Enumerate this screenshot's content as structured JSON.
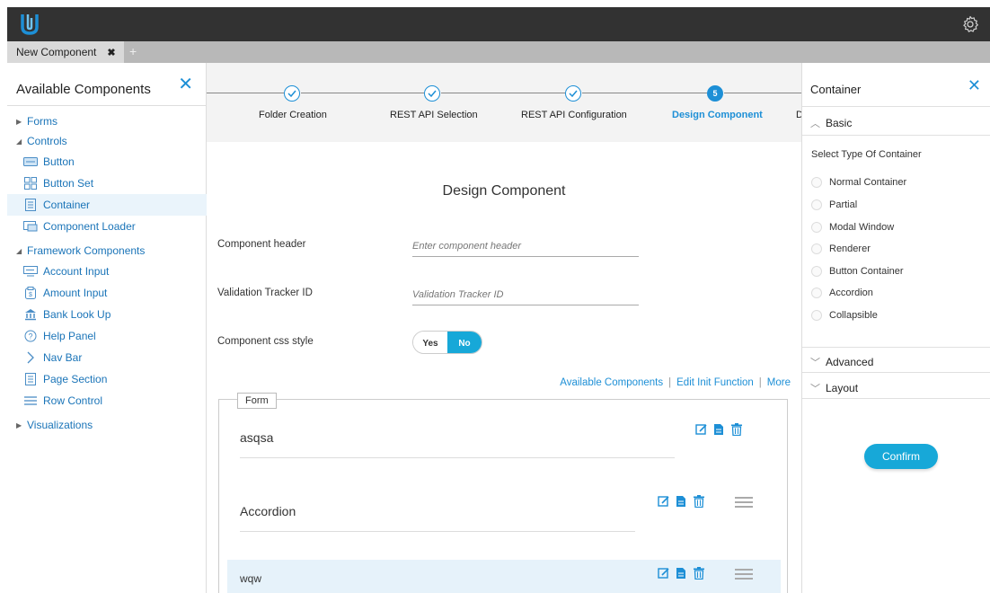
{
  "app": {
    "logo_icon": "u-logo-icon",
    "settings_icon": "gear-icon",
    "accent_color": "#1d8fd6",
    "topbar_color": "#323232"
  },
  "tabs": {
    "active_label": "New Component",
    "close_glyph": "✖",
    "add_glyph": "+"
  },
  "left_panel": {
    "title": "Available Components",
    "close_glyph": "✕",
    "groups": [
      {
        "label": "Forms",
        "expanded": false
      },
      {
        "label": "Controls",
        "expanded": true,
        "items": [
          "Button",
          "Button Set",
          "Container",
          "Component Loader"
        ]
      },
      {
        "label": "Framework Components",
        "expanded": true,
        "items": [
          "Account Input",
          "Amount Input",
          "Bank Look Up",
          "Help Panel",
          "Nav Bar",
          "Page Section",
          "Row Control"
        ]
      },
      {
        "label": "Visualizations",
        "expanded": false
      }
    ]
  },
  "steps": [
    {
      "label": "Folder Creation",
      "state": "done"
    },
    {
      "label": "REST API Selection",
      "state": "done"
    },
    {
      "label": "REST API Configuration",
      "state": "done"
    },
    {
      "label": "Design Component",
      "state": "current",
      "number": "5"
    },
    {
      "label": "D",
      "state": "upcoming"
    }
  ],
  "design": {
    "title": "Design Component",
    "header_label": "Component header",
    "header_placeholder": "Enter component header",
    "tracker_label": "Validation Tracker ID",
    "tracker_placeholder": "Validation Tracker ID",
    "css_label": "Component css style",
    "toggle_yes": "Yes",
    "toggle_no": "No",
    "toggle_selected": "No"
  },
  "links": {
    "available": "Available Components",
    "edit_init": "Edit Init Function",
    "more": "More"
  },
  "form": {
    "legend": "Form",
    "rows": [
      {
        "title": "asqsa"
      },
      {
        "title": "Accordion"
      },
      {
        "title": "wqw"
      }
    ]
  },
  "right_panel": {
    "title": "Container",
    "close_glyph": "✕",
    "basic_label": "Basic",
    "select_label": "Select Type Of Container",
    "options": [
      "Normal Container",
      "Partial",
      "Modal Window",
      "Renderer",
      "Button Container",
      "Accordion",
      "Collapsible"
    ],
    "advanced_label": "Advanced",
    "layout_label": "Layout",
    "confirm_label": "Confirm"
  }
}
